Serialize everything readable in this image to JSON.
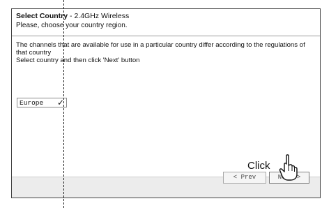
{
  "header": {
    "title_bold": "Select Country",
    "title_rest": " - 2.4GHz Wireless",
    "subtitle": "Please, choose your country region."
  },
  "body": {
    "line1": "The channels that are available for use in a particular country differ according to the regulations of that country",
    "line2": "Select country and then click 'Next' button"
  },
  "country_select": {
    "value": "Europe"
  },
  "footer": {
    "prev_label": "< Prev",
    "next_label": "Next >"
  },
  "annotation": {
    "callout": "Click"
  }
}
